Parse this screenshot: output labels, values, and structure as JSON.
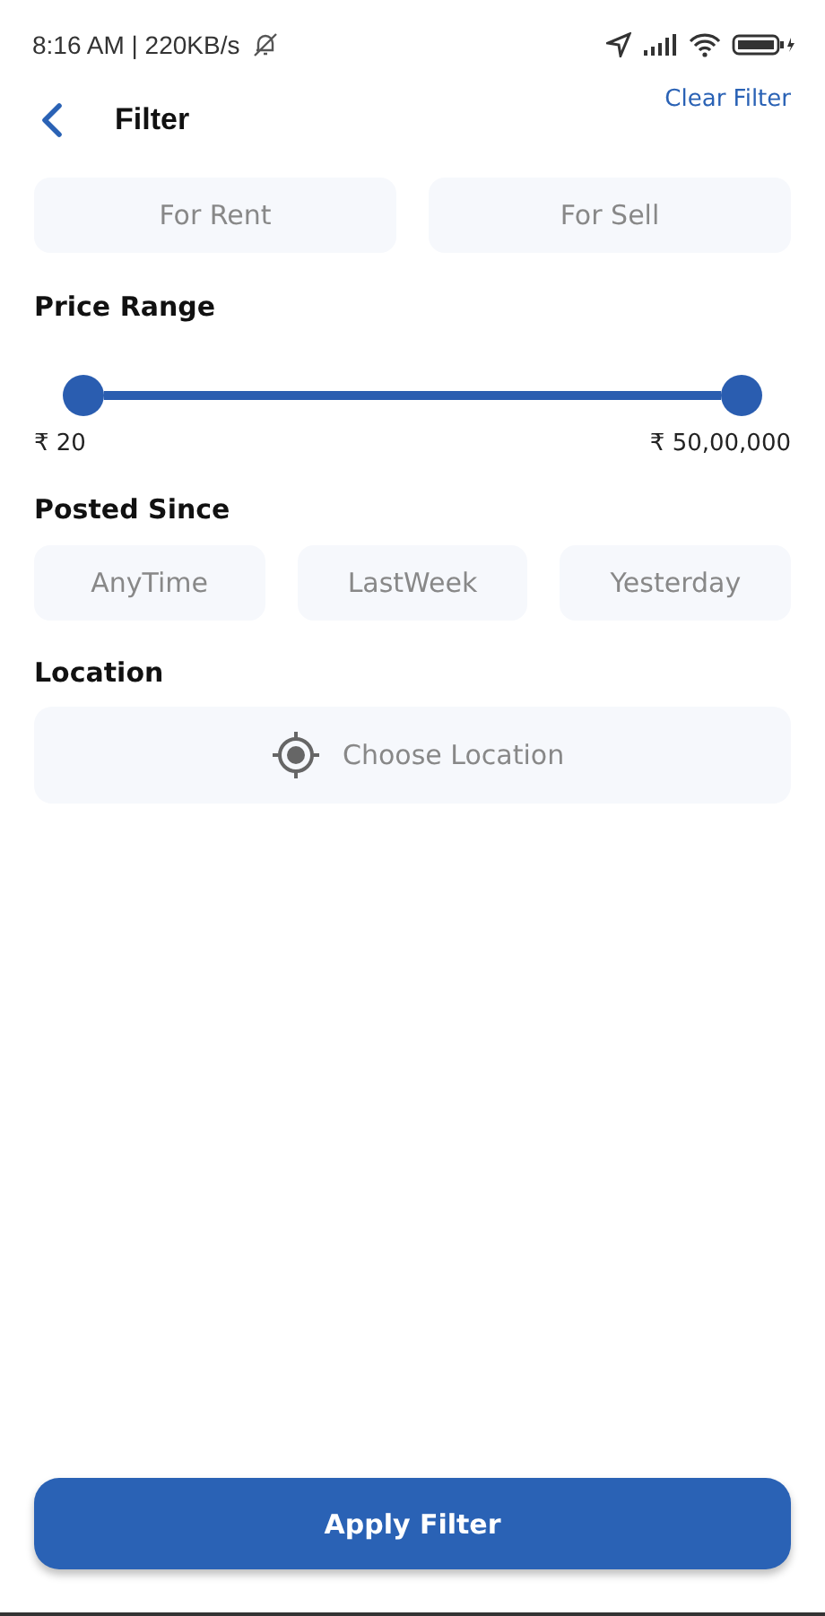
{
  "status_bar": {
    "time": "8:16 AM | 220KB/s"
  },
  "header": {
    "title": "Filter",
    "action": "Clear Filter"
  },
  "listing_types": [
    {
      "label": "For Rent",
      "selected": false
    },
    {
      "label": "For Sell",
      "selected": false
    }
  ],
  "price_range": {
    "title": "Price Range",
    "min_label": "₹ 20",
    "max_label": "₹ 50,00,000"
  },
  "posted_since": {
    "title": "Posted Since",
    "options": [
      {
        "label": "AnyTime",
        "selected": false
      },
      {
        "label": "LastWeek",
        "selected": false
      },
      {
        "label": "Yesterday",
        "selected": false
      }
    ]
  },
  "location": {
    "title": "Location",
    "placeholder": "Choose Location"
  },
  "apply_button": "Apply Filter"
}
